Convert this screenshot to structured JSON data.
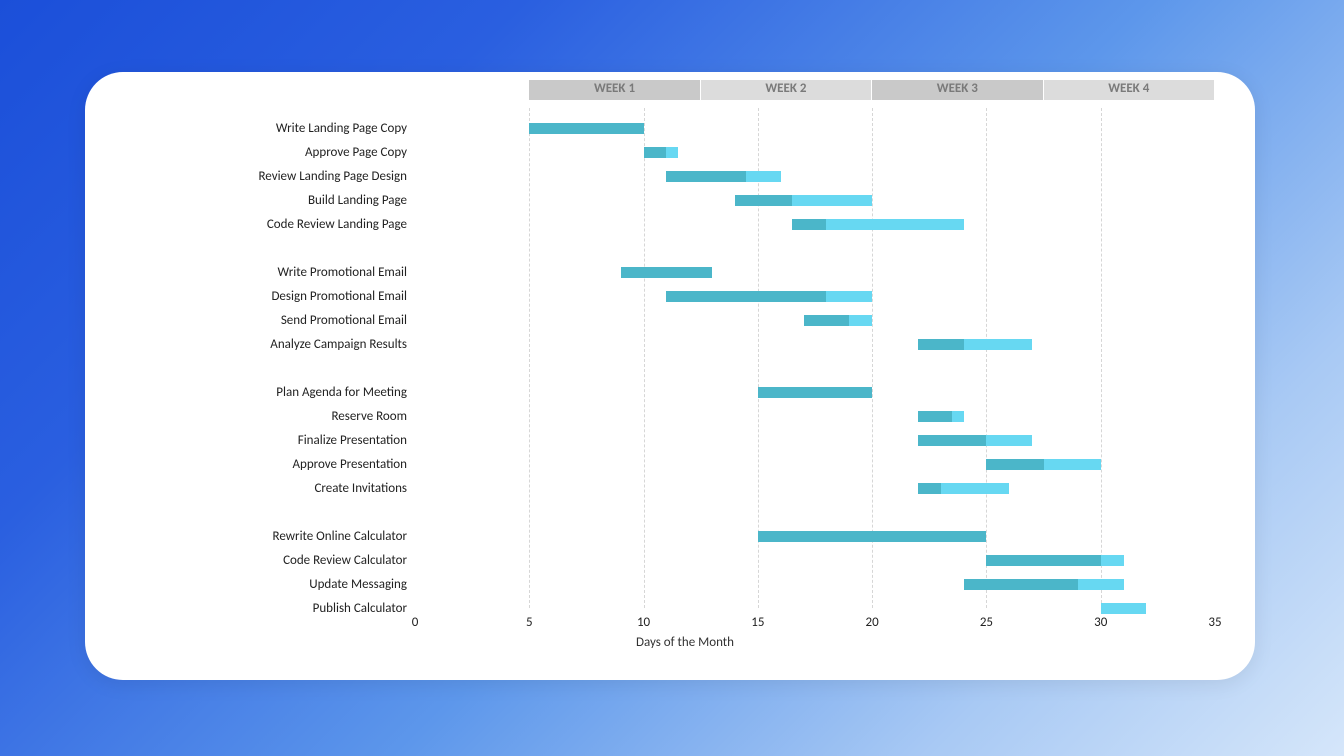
{
  "chart_data": {
    "type": "bar",
    "orientation": "horizontal-gantt",
    "xlabel": "Days of the Month",
    "ylabel": "",
    "xlim": [
      0,
      35
    ],
    "xticks": [
      0,
      5,
      10,
      15,
      20,
      25,
      30,
      35
    ],
    "grid_xticks": [
      5,
      10,
      15,
      20,
      25,
      30
    ],
    "week_headers": [
      "WEEK 1",
      "WEEK 2",
      "WEEK 3",
      "WEEK 4"
    ],
    "week_header_span": [
      5,
      35
    ],
    "colors": {
      "primary": "#4bb6c9",
      "secondary": "#67d8f2"
    },
    "tasks": [
      {
        "label": "Write Landing Page Copy",
        "start": 5,
        "seg1_end": 10,
        "end": 10
      },
      {
        "label": "Approve Page Copy",
        "start": 10,
        "seg1_end": 11,
        "end": 11.5
      },
      {
        "label": "Review Landing Page Design",
        "start": 11,
        "seg1_end": 14.5,
        "end": 16
      },
      {
        "label": "Build Landing Page",
        "start": 14,
        "seg1_end": 16.5,
        "end": 20
      },
      {
        "label": "Code Review Landing Page",
        "start": 16.5,
        "seg1_end": 18,
        "end": 24
      },
      {
        "spacer": true
      },
      {
        "label": "Write Promotional Email",
        "start": 9,
        "seg1_end": 13,
        "end": 13
      },
      {
        "label": "Design Promotional Email",
        "start": 11,
        "seg1_end": 18,
        "end": 20
      },
      {
        "label": "Send Promotional Email",
        "start": 17,
        "seg1_end": 19,
        "end": 20
      },
      {
        "label": "Analyze Campaign Results",
        "start": 22,
        "seg1_end": 24,
        "end": 27
      },
      {
        "spacer": true
      },
      {
        "label": "Plan Agenda for Meeting",
        "start": 15,
        "seg1_end": 20,
        "end": 20
      },
      {
        "label": "Reserve Room",
        "start": 22,
        "seg1_end": 23.5,
        "end": 24
      },
      {
        "label": "Finalize Presentation",
        "start": 22,
        "seg1_end": 25,
        "end": 27
      },
      {
        "label": "Approve Presentation",
        "start": 25,
        "seg1_end": 27.5,
        "end": 30
      },
      {
        "label": "Create Invitations",
        "start": 22,
        "seg1_end": 23,
        "end": 26
      },
      {
        "spacer": true
      },
      {
        "label": "Rewrite Online Calculator",
        "start": 15,
        "seg1_end": 25,
        "end": 25
      },
      {
        "label": "Code Review Calculator",
        "start": 25,
        "seg1_end": 30,
        "end": 31
      },
      {
        "label": "Update Messaging",
        "start": 24,
        "seg1_end": 29,
        "end": 31
      },
      {
        "label": "Publish Calculator",
        "start": 30,
        "seg1_end": 30,
        "end": 32
      }
    ]
  }
}
